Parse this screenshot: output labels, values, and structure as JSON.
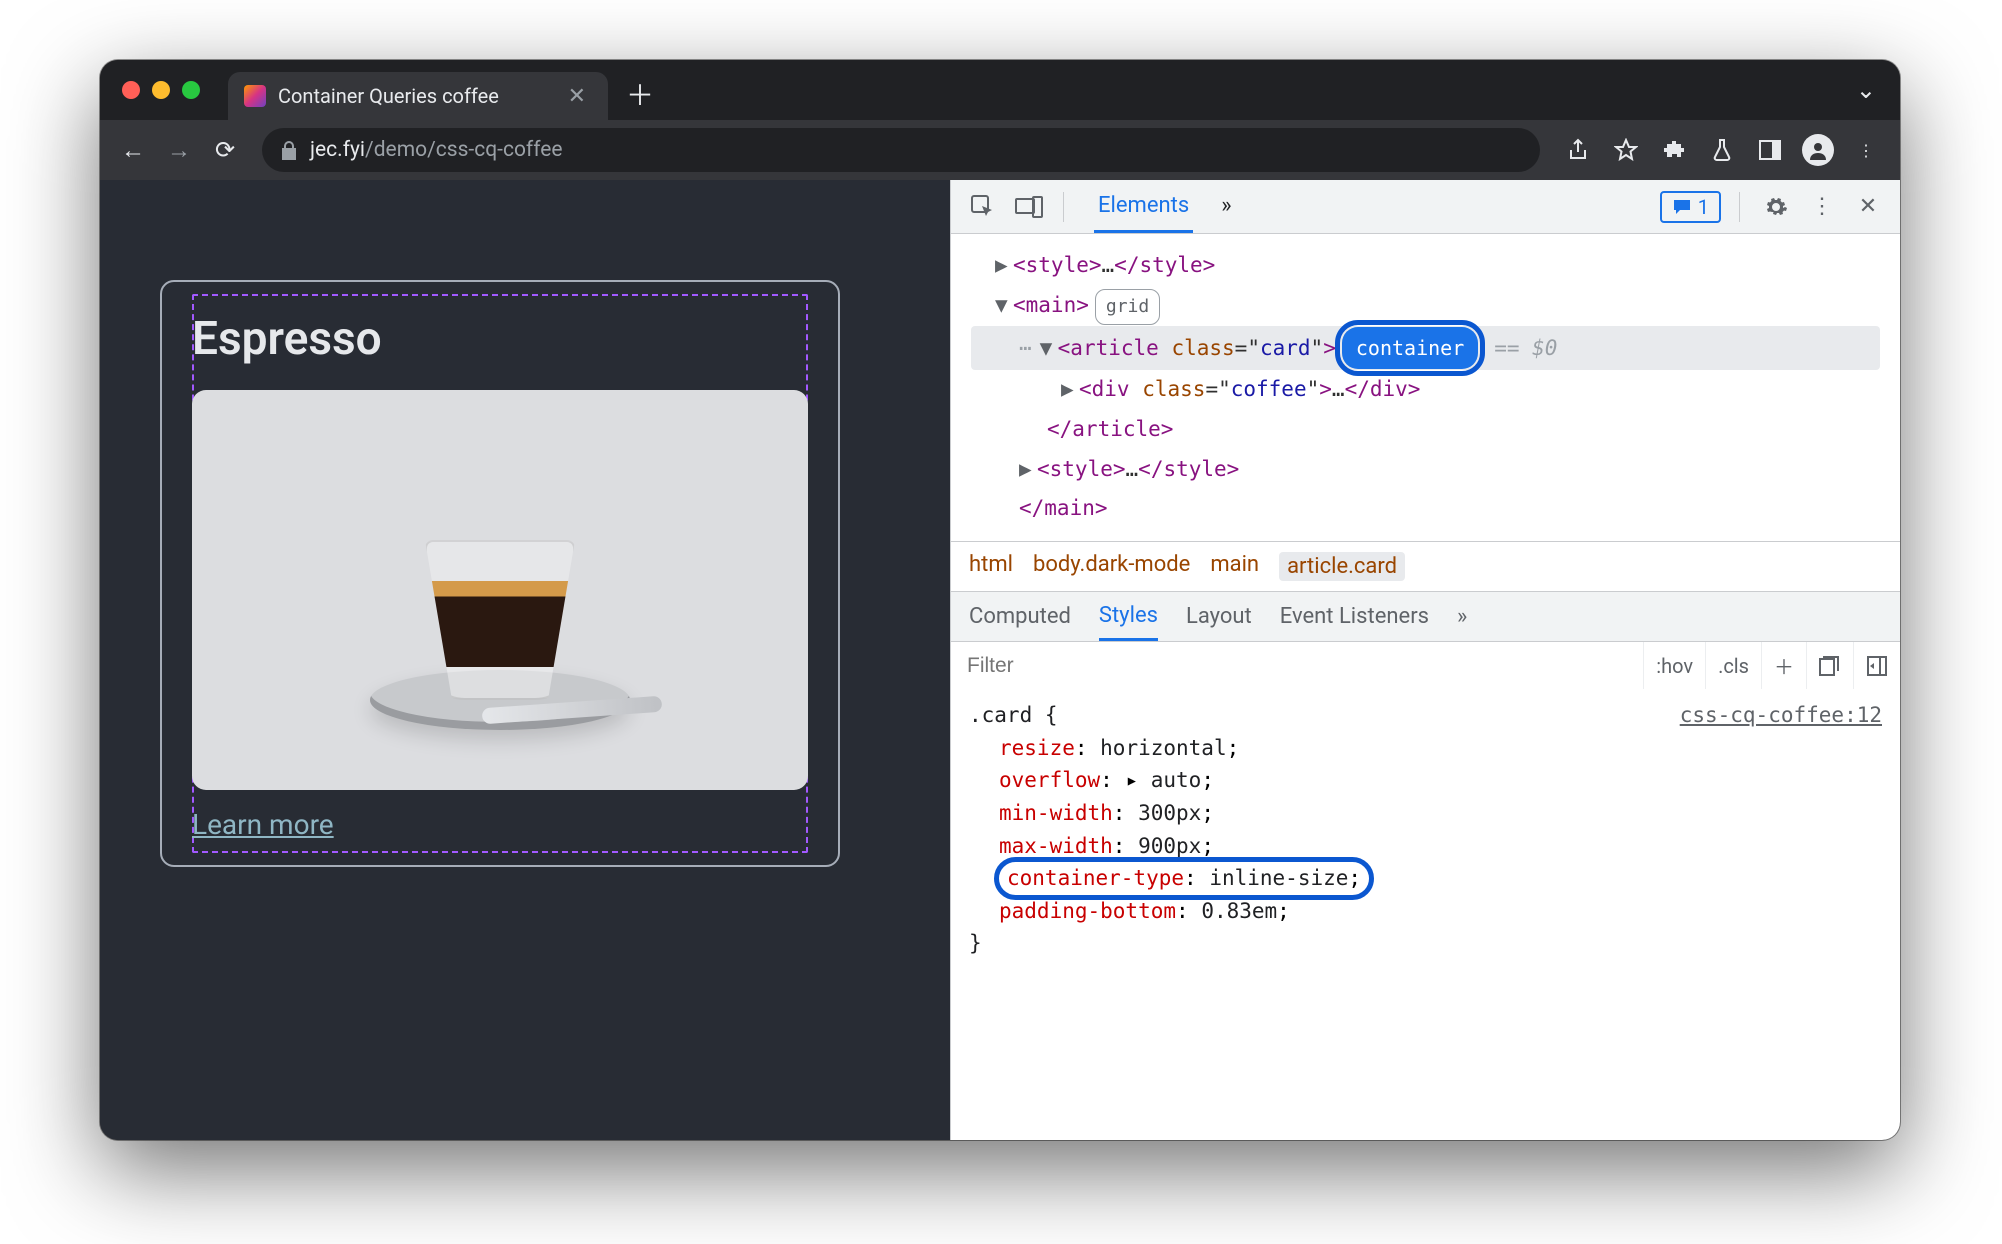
{
  "browser": {
    "tab_title": "Container Queries coffee",
    "url_host": "jec.fyi",
    "url_path": "/demo/css-cq-coffee"
  },
  "page": {
    "card_title": "Espresso",
    "learn_more": "Learn more"
  },
  "devtools": {
    "panels": {
      "elements": "Elements"
    },
    "issues_count": "1",
    "dom": {
      "style_open": "<style>",
      "style_ellipsis": "…",
      "style_close": "</style>",
      "main_open": "<main>",
      "grid_badge": "grid",
      "article_open_1": "<article ",
      "article_attr_name": "class",
      "article_attr_val": "card",
      "article_open_2": ">",
      "container_badge": "container",
      "eq0": "== $0",
      "div_open_1": "<div ",
      "div_attr_name": "class",
      "div_attr_val": "coffee",
      "div_open_2": ">",
      "div_ellipsis": "…",
      "div_close": "</div>",
      "article_close": "</article>",
      "style2_open": "<style>",
      "style2_ellipsis": "…",
      "style2_close": "</style>",
      "main_close": "</main>"
    },
    "breadcrumb": {
      "html": "html",
      "body": "body.dark-mode",
      "main": "main",
      "article": "article.card"
    },
    "styles_tabs": {
      "computed": "Computed",
      "styles": "Styles",
      "layout": "Layout",
      "events": "Event Listeners"
    },
    "filter_placeholder": "Filter",
    "filter_hov": ":hov",
    "filter_cls": ".cls",
    "css": {
      "selector": ".card {",
      "source": "css-cq-coffee:12",
      "p1": "resize",
      "v1": "horizontal",
      "p2": "overflow",
      "v2": "auto",
      "p3": "min-width",
      "v3": "300px",
      "p4": "max-width",
      "v4": "900px",
      "p5": "container-type",
      "v5": "inline-size",
      "p6": "padding-bottom",
      "v6": "0.83em",
      "close": "}"
    }
  }
}
